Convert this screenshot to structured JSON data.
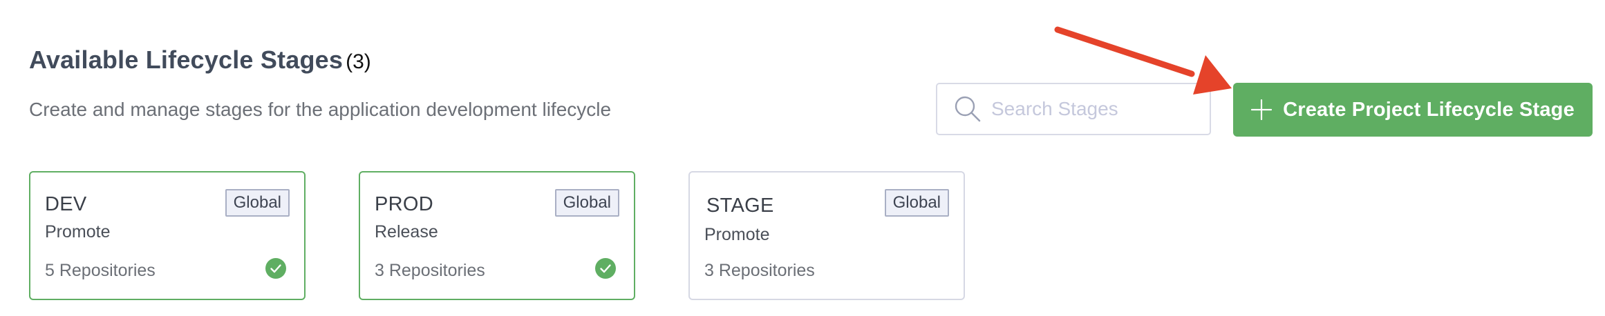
{
  "header": {
    "title": "Available Lifecycle Stages",
    "count": "(3)",
    "subtitle": "Create and manage stages for the application development lifecycle"
  },
  "search": {
    "placeholder": "Search Stages",
    "value": "",
    "icon": "search-icon"
  },
  "create_button": {
    "label": "Create Project Lifecycle Stage",
    "icon": "plus-icon",
    "color": "#5fae62"
  },
  "annotation": {
    "type": "arrow",
    "color": "#e5432a",
    "points_to": "create-project-lifecycle-stage-button"
  },
  "stages": [
    {
      "name": "DEV",
      "type": "Promote",
      "scope": "Global",
      "repositories": "5 Repositories",
      "active": true
    },
    {
      "name": "PROD",
      "type": "Release",
      "scope": "Global",
      "repositories": "3 Repositories",
      "active": true
    },
    {
      "name": "STAGE",
      "type": "Promote",
      "scope": "Global",
      "repositories": "3 Repositories",
      "active": false
    }
  ],
  "colors": {
    "active_border": "#5fae62",
    "inactive_border": "#d6d8e4",
    "check": "#5fae62",
    "badge_bg": "#eef0f8"
  }
}
